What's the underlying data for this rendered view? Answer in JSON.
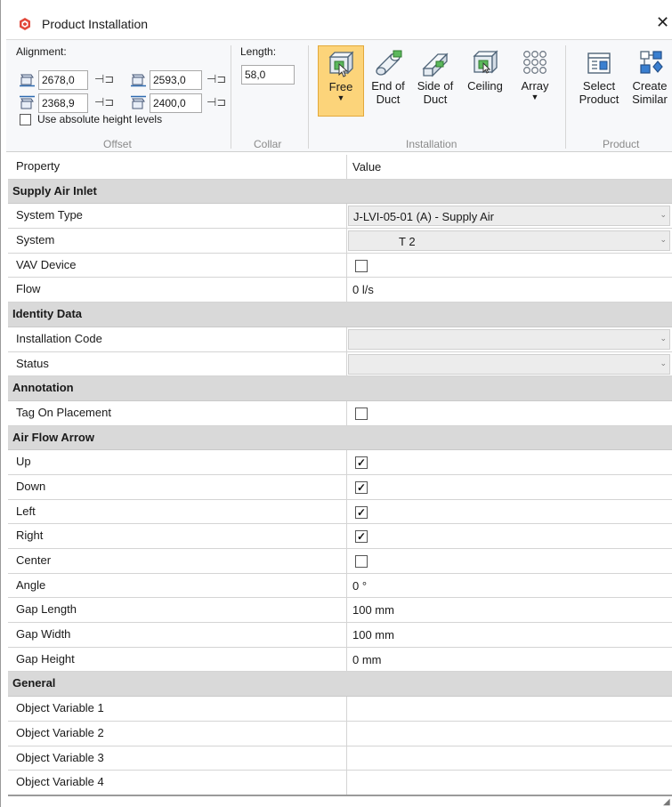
{
  "window": {
    "title": "Product Installation",
    "close_symbol": "✕"
  },
  "ribbon": {
    "offset": {
      "group_label": "Offset",
      "alignment_label": "Alignment:",
      "values": [
        "2678,0",
        "2593,0",
        "2368,9",
        "2400,0"
      ],
      "absolute_height_label": "Use absolute height levels",
      "absolute_height_checked": false
    },
    "collar": {
      "group_label": "Collar",
      "length_label": "Length:",
      "length_value": "58,0"
    },
    "installation": {
      "group_label": "Installation",
      "buttons": [
        {
          "line1": "Free",
          "line2": "",
          "has_dropdown": true,
          "active": true,
          "icon": "free-install-icon"
        },
        {
          "line1": "End of",
          "line2": "Duct",
          "has_dropdown": false,
          "active": false,
          "icon": "end-of-duct-icon"
        },
        {
          "line1": "Side of",
          "line2": "Duct",
          "has_dropdown": false,
          "active": false,
          "icon": "side-of-duct-icon"
        },
        {
          "line1": "Ceiling",
          "line2": "",
          "has_dropdown": false,
          "active": false,
          "icon": "ceiling-icon"
        },
        {
          "line1": "Array",
          "line2": "",
          "has_dropdown": true,
          "active": false,
          "icon": "array-icon"
        }
      ]
    },
    "product": {
      "group_label": "Product",
      "buttons": [
        {
          "line1": "Select",
          "line2": "Product",
          "icon": "select-product-icon"
        },
        {
          "line1": "Create",
          "line2": "Similar",
          "icon": "create-similar-icon"
        }
      ]
    }
  },
  "grid": {
    "header": {
      "property": "Property",
      "value": "Value"
    },
    "categories": {
      "supply_air_inlet": "Supply Air Inlet",
      "identity_data": "Identity Data",
      "annotation": "Annotation",
      "air_flow_arrow": "Air Flow Arrow",
      "general": "General"
    },
    "rows": {
      "system_type": {
        "name": "System Type",
        "value": "J-LVI-05-01 (A) - Supply Air"
      },
      "system": {
        "name": "System",
        "value": "T 2"
      },
      "vav_device": {
        "name": "VAV Device",
        "checked": false
      },
      "flow": {
        "name": "Flow",
        "value": "0 l/s"
      },
      "installation_code": {
        "name": "Installation Code",
        "value": ""
      },
      "status": {
        "name": "Status",
        "value": ""
      },
      "tag_on_placement": {
        "name": "Tag On Placement",
        "checked": false
      },
      "up": {
        "name": "Up",
        "checked": true
      },
      "down": {
        "name": "Down",
        "checked": true
      },
      "left": {
        "name": "Left",
        "checked": true
      },
      "right": {
        "name": "Right",
        "checked": true
      },
      "center": {
        "name": "Center",
        "checked": false
      },
      "angle": {
        "name": "Angle",
        "value": "0 °"
      },
      "gap_length": {
        "name": "Gap Length",
        "value": "100 mm"
      },
      "gap_width": {
        "name": "Gap Width",
        "value": "100 mm"
      },
      "gap_height": {
        "name": "Gap Height",
        "value": "0 mm"
      },
      "object_variable_1": {
        "name": "Object Variable 1",
        "value": ""
      },
      "object_variable_2": {
        "name": "Object Variable 2",
        "value": ""
      },
      "object_variable_3": {
        "name": "Object Variable 3",
        "value": ""
      },
      "object_variable_4": {
        "name": "Object Variable 4",
        "value": ""
      }
    },
    "check_mark": "✓",
    "dropdown_glyph": "⌄"
  },
  "colors": {
    "active_button": "#fcd47a",
    "category_band": "#d9d9d9",
    "ribbon_bg": "#f7f8fa",
    "app_icon": "#e2493b"
  }
}
